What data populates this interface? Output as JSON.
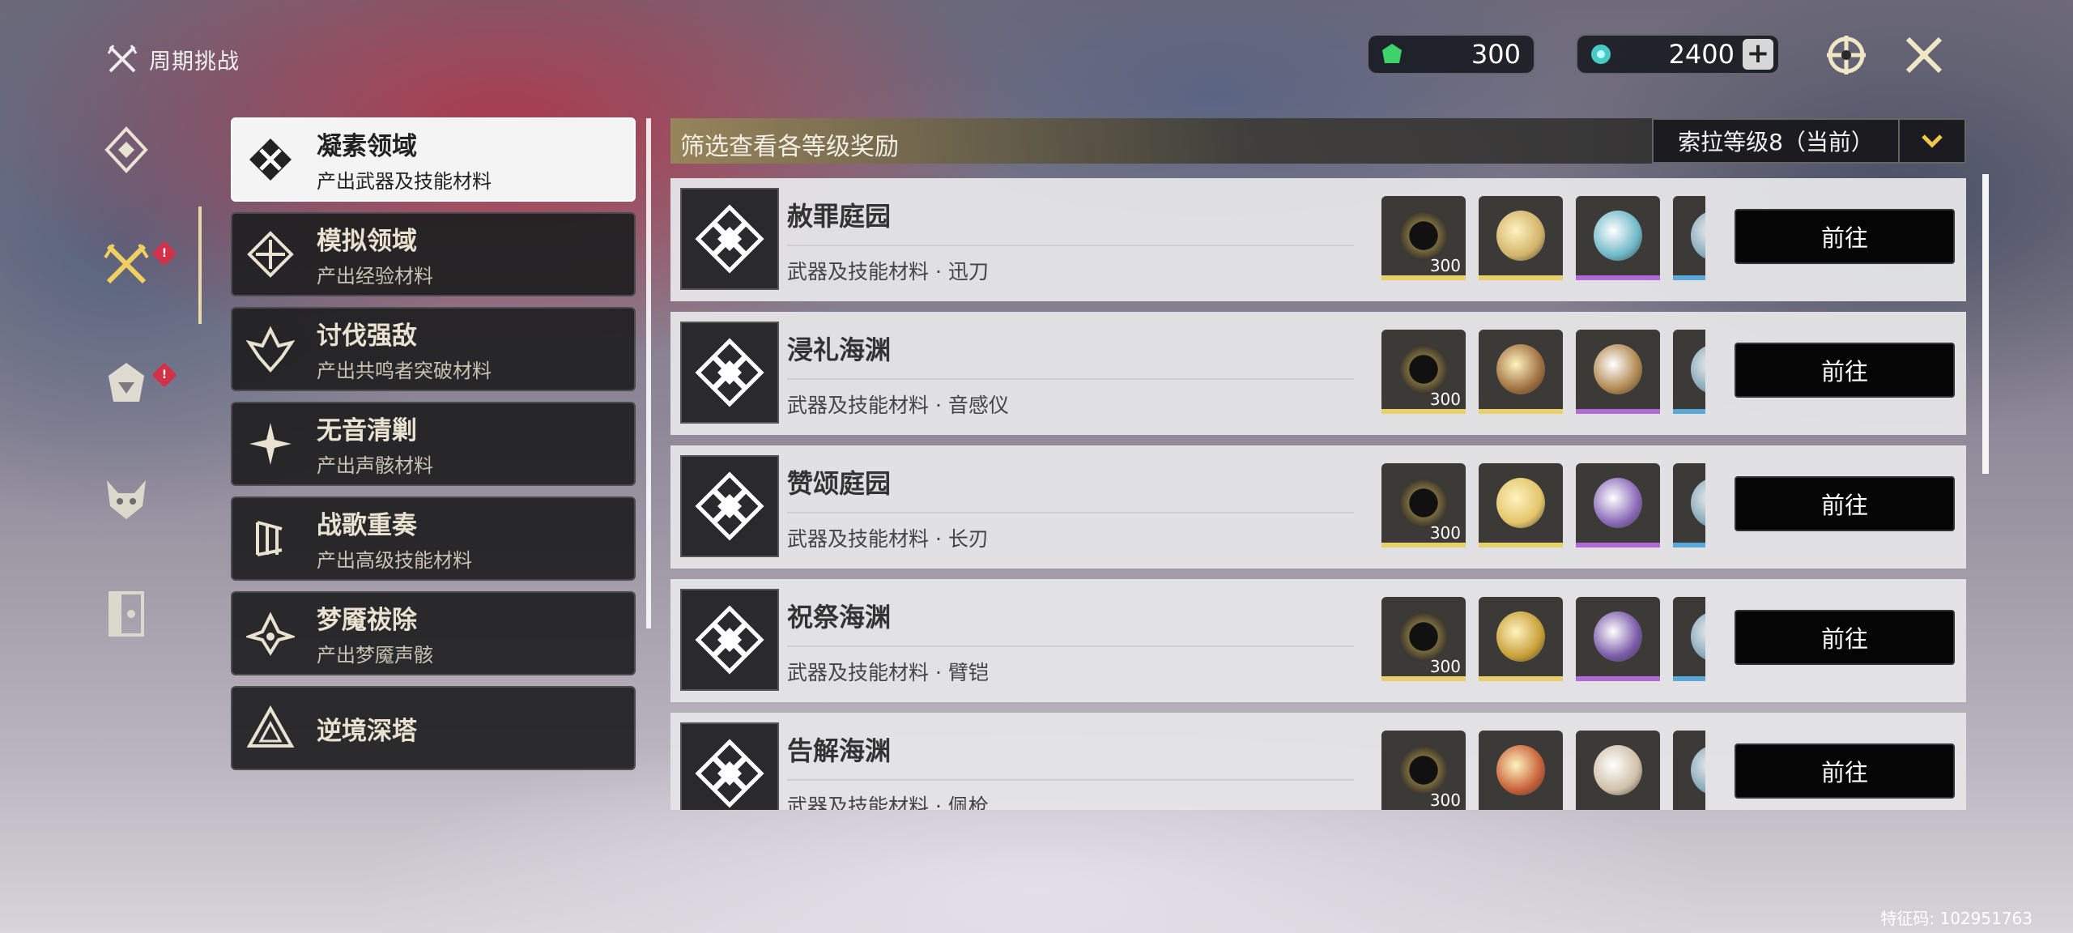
{
  "header": {
    "title": "周期挑战"
  },
  "currency": [
    {
      "name": "green-crystal",
      "value": "300",
      "color": "#3fd26b"
    },
    {
      "name": "astrite",
      "value": "2400",
      "color": "#47c9c4",
      "plus": "+"
    }
  ],
  "rail": [
    {
      "icon": "diamond-rune-icon",
      "badge": ""
    },
    {
      "icon": "crossed-swords-icon",
      "badge": "!",
      "active": true
    },
    {
      "icon": "monster-head-icon",
      "badge": "!"
    },
    {
      "icon": "demon-mask-icon",
      "badge": ""
    },
    {
      "icon": "gate-icon",
      "badge": ""
    }
  ],
  "categories": [
    {
      "name": "凝素领域",
      "sub": "产出武器及技能材料",
      "active": true
    },
    {
      "name": "模拟领域",
      "sub": "产出经验材料"
    },
    {
      "name": "讨伐强敌",
      "sub": "产出共鸣者突破材料"
    },
    {
      "name": "无音清剿",
      "sub": "产出声骸材料"
    },
    {
      "name": "战歌重奏",
      "sub": "产出高级技能材料"
    },
    {
      "name": "梦魇祓除",
      "sub": "产出梦魇声骸"
    },
    {
      "name": "逆境深塔",
      "sub": ""
    }
  ],
  "filter": {
    "label": "筛选查看各等级奖励",
    "level": "索拉等级8（当前）"
  },
  "domains": [
    {
      "name": "赦罪庭园",
      "desc": "武器及技能材料 · 迅刀",
      "qty": "300",
      "go": "前往",
      "orbs": [
        "#d2b46a",
        "#6fb8c8"
      ]
    },
    {
      "name": "浸礼海渊",
      "desc": "武器及技能材料 · 音感仪",
      "qty": "300",
      "go": "前往",
      "orbs": [
        "#a07040",
        "#b08850"
      ]
    },
    {
      "name": "赞颂庭园",
      "desc": "武器及技能材料 · 长刃",
      "qty": "300",
      "go": "前往",
      "orbs": [
        "#e3c46a",
        "#8a6ab8"
      ]
    },
    {
      "name": "祝祭海渊",
      "desc": "武器及技能材料 · 臂铠",
      "qty": "300",
      "go": "前往",
      "orbs": [
        "#c8a038",
        "#7a5aa8"
      ]
    },
    {
      "name": "告解海渊",
      "desc": "武器及技能材料 · 佩枪",
      "qty": "300",
      "go": "前往",
      "orbs": [
        "#c86038",
        "#d0c0a8"
      ]
    }
  ],
  "footer": {
    "code": "特征码: 102951763"
  }
}
